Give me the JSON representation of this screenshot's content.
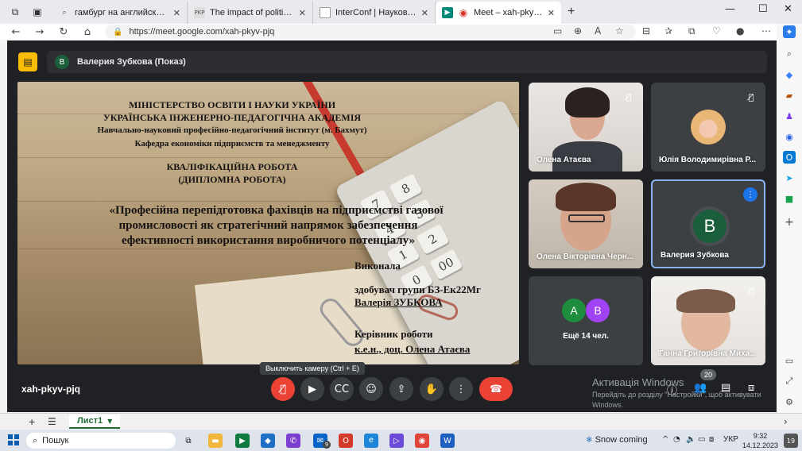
{
  "browser": {
    "tabs": [
      {
        "title": "гамбург на английском - Поиск",
        "favicon": "search-icon"
      },
      {
        "title": "The impact of political stability o",
        "favicon": "doc-icon"
      },
      {
        "title": "InterConf | Наукова конференці",
        "favicon": "page-icon"
      },
      {
        "title": "Meet – xah-pkyv-pjq",
        "favicon": "meet-icon",
        "active": true
      }
    ],
    "url": "https://meet.google.com/xah-pkyv-pjq"
  },
  "meet": {
    "presenter_label": "Валерия Зубкова (Показ)",
    "presenter_initial": "В",
    "meeting_code": "xah-pkyv-pjq",
    "tooltip": "Выключить камеру (Ctrl + E)",
    "participant_count": "20",
    "participants": [
      {
        "name": "Олена Атаєва",
        "muted": true
      },
      {
        "name": "Юлія Володимирівна Р...",
        "muted": true
      },
      {
        "name": "Олена Вікторівна Черн...",
        "muted": false
      },
      {
        "name": "Валерия Зубкова",
        "initial": "В",
        "speaking": true
      },
      {
        "name": "Ещё 14 чел.",
        "initials": [
          "А",
          "В"
        ]
      },
      {
        "name": "Ганна Григорівна Миха...",
        "muted": true
      }
    ],
    "colors": {
      "background": "#202124",
      "danger": "#ea4335",
      "accent": "#1a73e8",
      "presenting": "#fbbc04"
    }
  },
  "slide": {
    "line1": "МІНІСТЕРСТВО ОСВІТИ І НАУКИ УКРАЇНИ",
    "line2": "УКРАЇНСЬКА ІНЖЕНЕРНО-ПЕДАГОГІЧНА АКАДЕМІЯ",
    "line3": "Навчально-науковий професійно-педагогічний інститут (м. Бахмут)",
    "line4": "Кафедра економіки підприємств та менеджменту",
    "line5": "КВАЛІФІКАЦІЙНА РОБОТА",
    "line6": "(ДИПЛОМНА РОБОТА)",
    "title1": "«Професійна перепідготовка фахівців на підприємстві газової",
    "title2": "промисловості як стратегічний напрямок забезпечення",
    "title3": "ефективності використання виробничого потенціалу»",
    "done_by": "Виконала",
    "student_group": "здобувач групи БЗ-Ек22Мг",
    "student_name": "Валерія ЗУБКОВА",
    "supervisor_label": "Керівник роботи",
    "supervisor_name": "к.е.н., доц. Олена Атаєва",
    "calc_keys": [
      "7",
      "4",
      "1",
      "2",
      "5",
      "0",
      "00",
      "8"
    ]
  },
  "watermark": {
    "title": "Активація Windows",
    "text": "Перейдіть до розділу \"Настройки\", щоб активувати Windows."
  },
  "sheet": {
    "tab": "Лист1"
  },
  "taskbar": {
    "search_placeholder": "Пошук",
    "weather": "Snow coming",
    "lang": "УКР",
    "time": "9:32",
    "date": "14.12.2023",
    "notifications": "19",
    "mail_badge": "9"
  }
}
